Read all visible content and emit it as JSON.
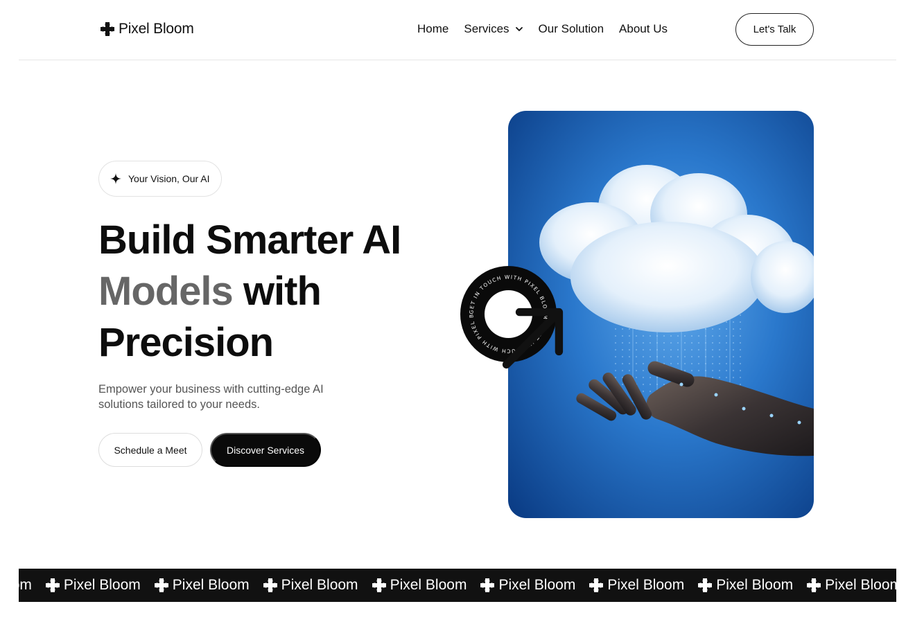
{
  "brand": {
    "name": "Pixel Bloom",
    "icon": "plus-flower-icon"
  },
  "nav": {
    "items": [
      {
        "label": "Home"
      },
      {
        "label": "Services",
        "has_dropdown": true
      },
      {
        "label": "Our Solution"
      },
      {
        "label": "About Us"
      }
    ],
    "cta_label": "Let's Talk"
  },
  "hero": {
    "tag_label": "Your Vision, Our AI",
    "headline_line1": "Build Smarter AI",
    "headline_word_muted": "Models",
    "headline_word_rest": "with",
    "headline_line3": "Precision",
    "subtext": "Empower your business with cutting-edge AI solutions tailored to your needs.",
    "primary_button": "Schedule a Meet",
    "secondary_button": "Discover Services",
    "badge_text": "GET IN TOUCH WITH PIXEL BLOOM · GET IN TOUCH WITH PIXEL BLOOM ·"
  },
  "marquee": {
    "items": [
      "Pixel Bloom",
      "Pixel Bloom",
      "Pixel Bloom",
      "Pixel Bloom",
      "Pixel Bloom",
      "Pixel Bloom",
      "Pixel Bloom",
      "Pixel Bloom",
      "Pixel Bloom"
    ]
  },
  "colors": {
    "accent_dark": "#0a0a0a",
    "muted_text": "#666666",
    "image_blue": "#1a5fb4"
  }
}
